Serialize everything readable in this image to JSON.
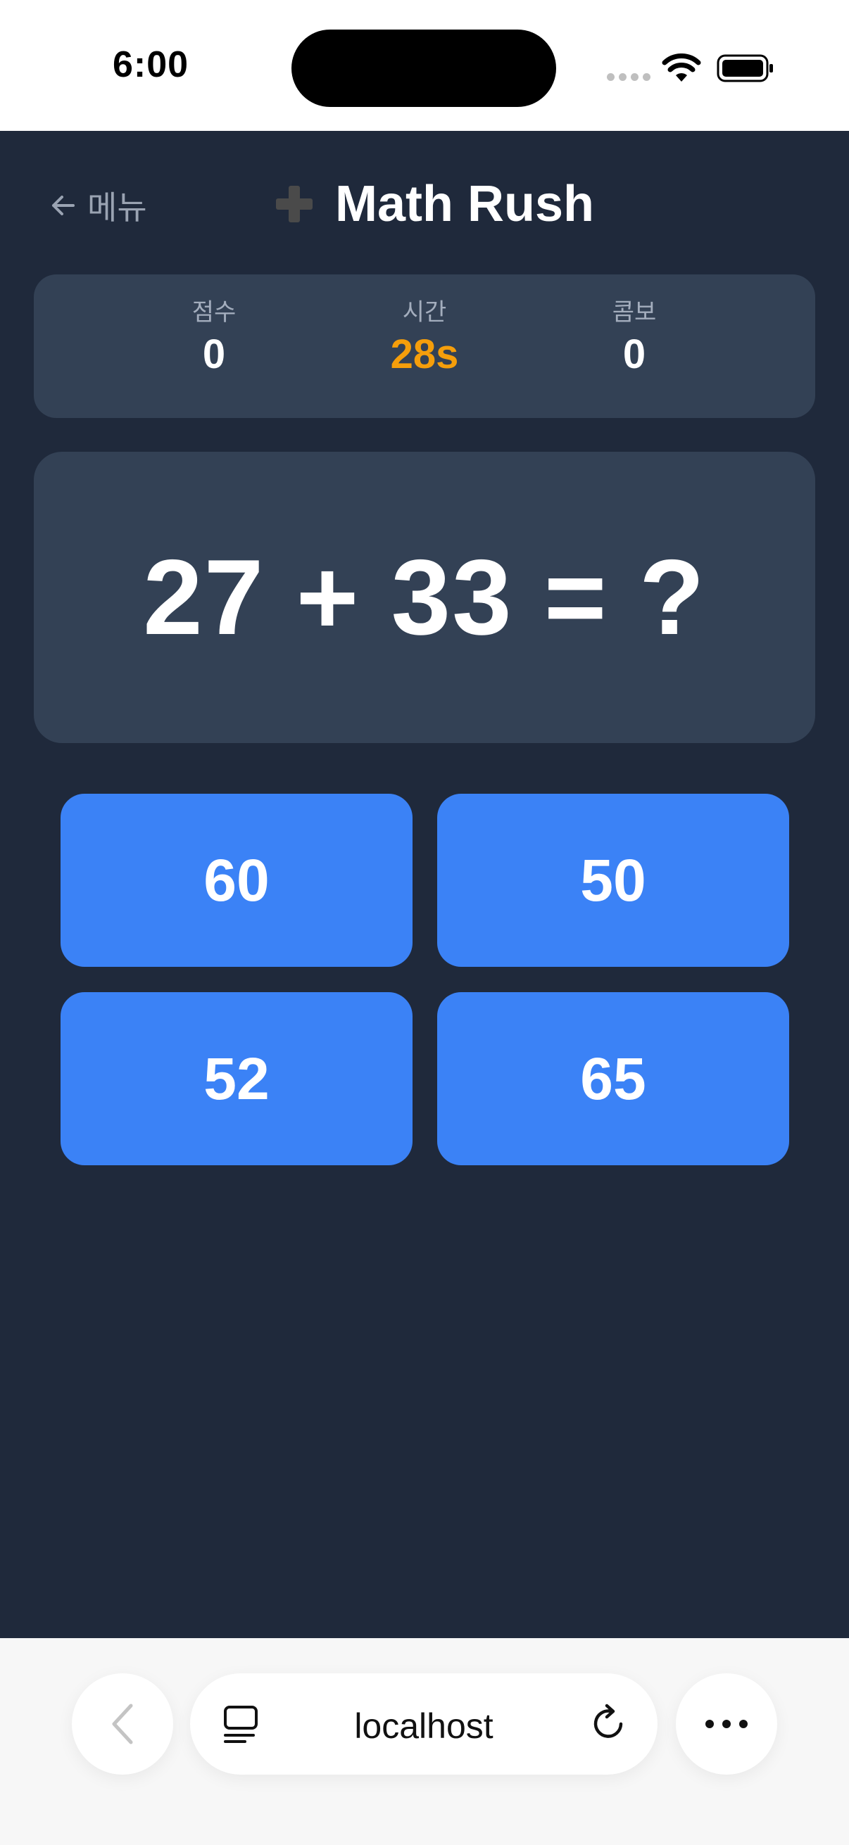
{
  "status_bar": {
    "time": "6:00"
  },
  "header": {
    "back_label": "메뉴",
    "title": "Math Rush"
  },
  "stats": {
    "score": {
      "label": "점수",
      "value": "0"
    },
    "time": {
      "label": "시간",
      "value": "28s"
    },
    "combo": {
      "label": "콤보",
      "value": "0"
    }
  },
  "question": {
    "text": "27 + 33 = ?"
  },
  "answers": [
    "60",
    "50",
    "52",
    "65"
  ],
  "browser": {
    "url": "localhost"
  },
  "colors": {
    "background": "#1f293b",
    "panel": "#334155",
    "answer_button": "#3b82f6",
    "timer": "#f59e0b"
  }
}
